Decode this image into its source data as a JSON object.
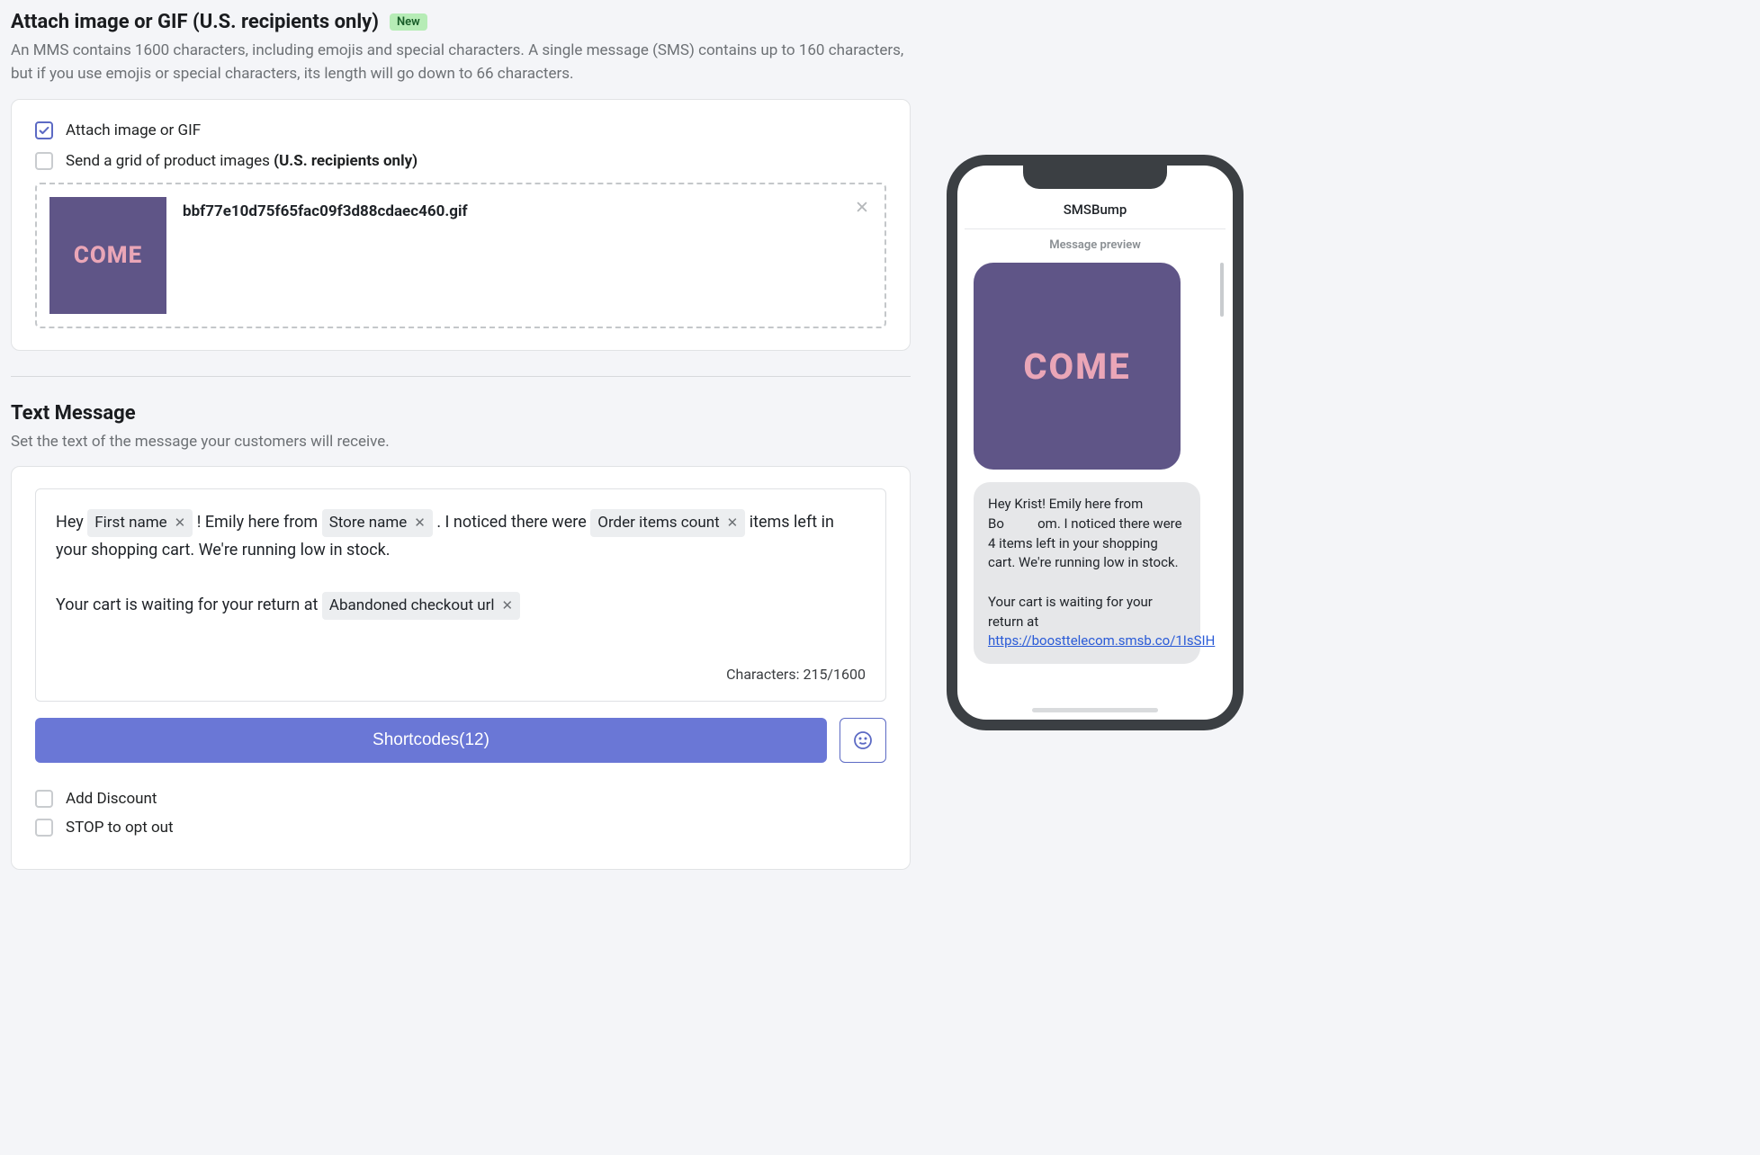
{
  "attachSection": {
    "title": "Attach image or GIF (U.S. recipients only)",
    "badge": "New",
    "desc": "An MMS contains 1600 characters, including emojis and special characters. A single message (SMS) contains up to 160 characters, but if you use emojis or special characters, its length will go down to 66 characters.",
    "chkAttach": "Attach image or GIF",
    "chkGridPrefix": "Send a grid of product images ",
    "chkGridBold": "(U.S. recipients only)",
    "filename": "bbf77e10d75f65fac09f3d88cdaec460.gif",
    "thumbText": "COME"
  },
  "textSection": {
    "title": "Text Message",
    "desc": "Set the text of the message your customers will receive."
  },
  "editor": {
    "t1": "Hey ",
    "pill1": "First name",
    "t2": " ! Emily here from ",
    "pill2": "Store name",
    "t3": " . I noticed there were ",
    "pill3": "Order items count",
    "t4": " items left in your shopping cart. We're running low in stock.",
    "t5": "Your cart is waiting for your return at ",
    "pill4": "Abandoned checkout url",
    "charCount": "Characters: 215/1600"
  },
  "shortcodes": {
    "label": "Shortcodes(12)"
  },
  "lowerOpts": {
    "addDiscount": "Add Discount",
    "stopOptOut": "STOP to opt out"
  },
  "phone": {
    "header": "SMSBump",
    "sub": "Message preview",
    "imgText": "COME",
    "bubble1a": "Hey Krist! Emily here from Bo",
    "bubble1b": "om. I noticed there were 4 items left in your shopping cart. We're running low in stock.",
    "bubble2": "Your cart is waiting for your return at ",
    "link": "https://boosttelecom.smsb.co/1IsSIH"
  }
}
